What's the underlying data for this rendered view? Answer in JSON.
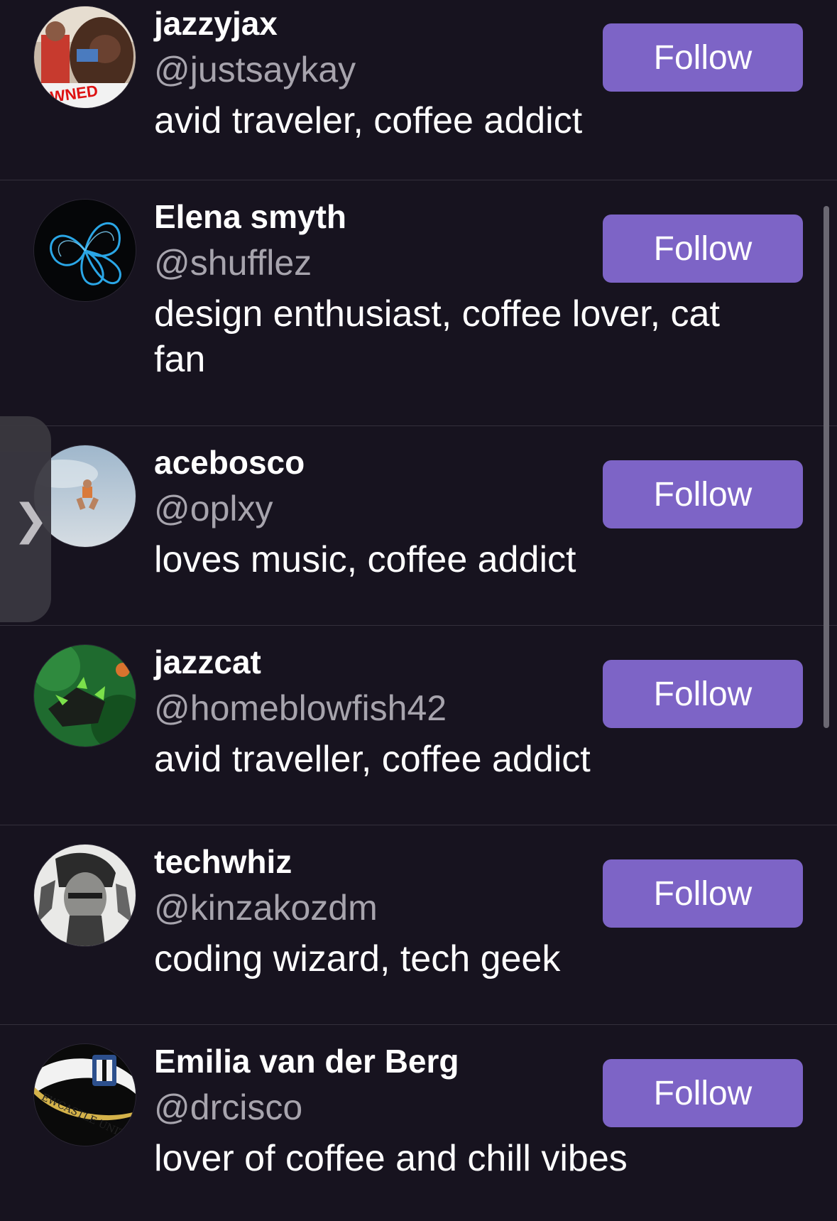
{
  "users": [
    {
      "name": "jazzyjax",
      "handle": "@justsaykay",
      "bio": "avid traveler, coffee addict",
      "follow_label": "Follow",
      "avatar_icon": "avatar-ape-photo"
    },
    {
      "name": "Elena smyth",
      "handle": "@shufflez",
      "bio": "design enthusiast, coffee lover, cat fan",
      "follow_label": "Follow",
      "avatar_icon": "avatar-blue-butterfly"
    },
    {
      "name": "acebosco",
      "handle": "@oplxy",
      "bio": "loves music, coffee addict",
      "follow_label": "Follow",
      "avatar_icon": "avatar-jumper-sky"
    },
    {
      "name": "jazzcat",
      "handle": "@homeblowfish42",
      "bio": "avid traveller, coffee addict",
      "follow_label": "Follow",
      "avatar_icon": "avatar-green-creature"
    },
    {
      "name": "techwhiz",
      "handle": "@kinzakozdm",
      "bio": "coding wizard, tech geek",
      "follow_label": "Follow",
      "avatar_icon": "avatar-sketch-portrait"
    },
    {
      "name": "Emilia van der Berg",
      "handle": "@drcisco",
      "bio": "lover of coffee and chill vibes",
      "follow_label": "Follow",
      "avatar_icon": "avatar-newcastle-crest"
    }
  ],
  "colors": {
    "background": "#17131f",
    "button": "#7d64c6",
    "handle_text": "#a7a4ad",
    "divider": "#34303c"
  }
}
